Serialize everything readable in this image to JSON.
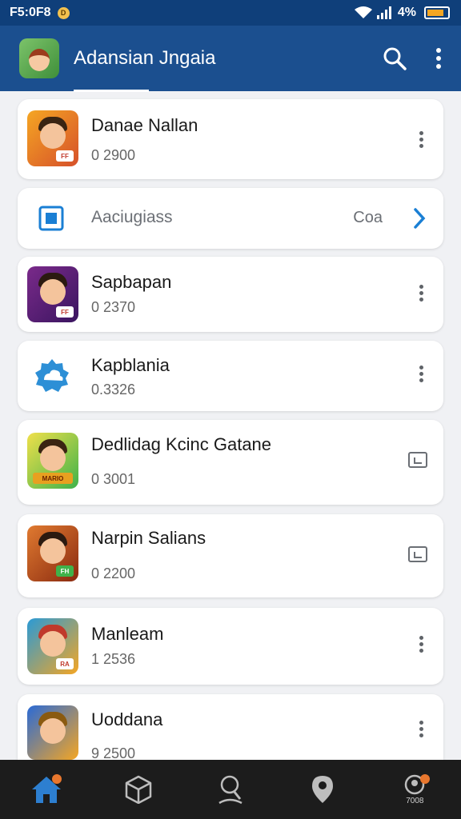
{
  "status_bar": {
    "time": "F5:0F8",
    "notification_glyph": "D",
    "battery_text": "4%"
  },
  "app_bar": {
    "title": "Adansian Jngaia",
    "logo_icon": "app-logo-icon",
    "search_icon": "search-icon",
    "more_icon": "more-vert-icon"
  },
  "items": [
    {
      "title": "Danae Nallan",
      "subtitle": "0 2900",
      "icon": "game-portrait-icon",
      "tag": "FF",
      "action": "more"
    },
    {
      "title": "Aaciugiass",
      "subtitle": "",
      "trailing": "Coa",
      "icon": "square-icon",
      "action": "chevron"
    },
    {
      "title": "Sapbapan",
      "subtitle": "0 2370",
      "icon": "game-portrait-icon",
      "tag": "FF",
      "action": "more"
    },
    {
      "title": "Kapblania",
      "subtitle": "0.3326",
      "icon": "cloud-icon",
      "action": "more"
    },
    {
      "title": "Dedlidag Kcinc Gatane",
      "subtitle": "0 3001",
      "icon": "game-portrait-icon",
      "tag": "MARIO",
      "action": "open"
    },
    {
      "title": "Narpin Salians",
      "subtitle": "0 2200",
      "icon": "game-portrait-icon",
      "tag": "FH",
      "action": "open"
    },
    {
      "title": "Manleam",
      "subtitle": "1 2536",
      "icon": "game-portrait-icon",
      "tag": "RA",
      "action": "more"
    },
    {
      "title": "Uoddana",
      "subtitle": "9 2500",
      "icon": "game-portrait-icon",
      "tag": "",
      "action": "more"
    }
  ],
  "bottom_nav": [
    {
      "icon": "home-icon",
      "label": "",
      "badge": true,
      "active": true
    },
    {
      "icon": "box-icon",
      "label": "",
      "badge": false,
      "active": false
    },
    {
      "icon": "search-person-icon",
      "label": "",
      "badge": false,
      "active": false
    },
    {
      "icon": "location-icon",
      "label": "",
      "badge": false,
      "active": false
    },
    {
      "icon": "profile-icon",
      "label": "7008",
      "badge": true,
      "active": false
    }
  ],
  "colors": {
    "status_bar": "#0f3f7a",
    "app_bar": "#1b4f8f",
    "background": "#f0f1f4",
    "accent": "#1a7fd4",
    "badge": "#e8772e"
  }
}
